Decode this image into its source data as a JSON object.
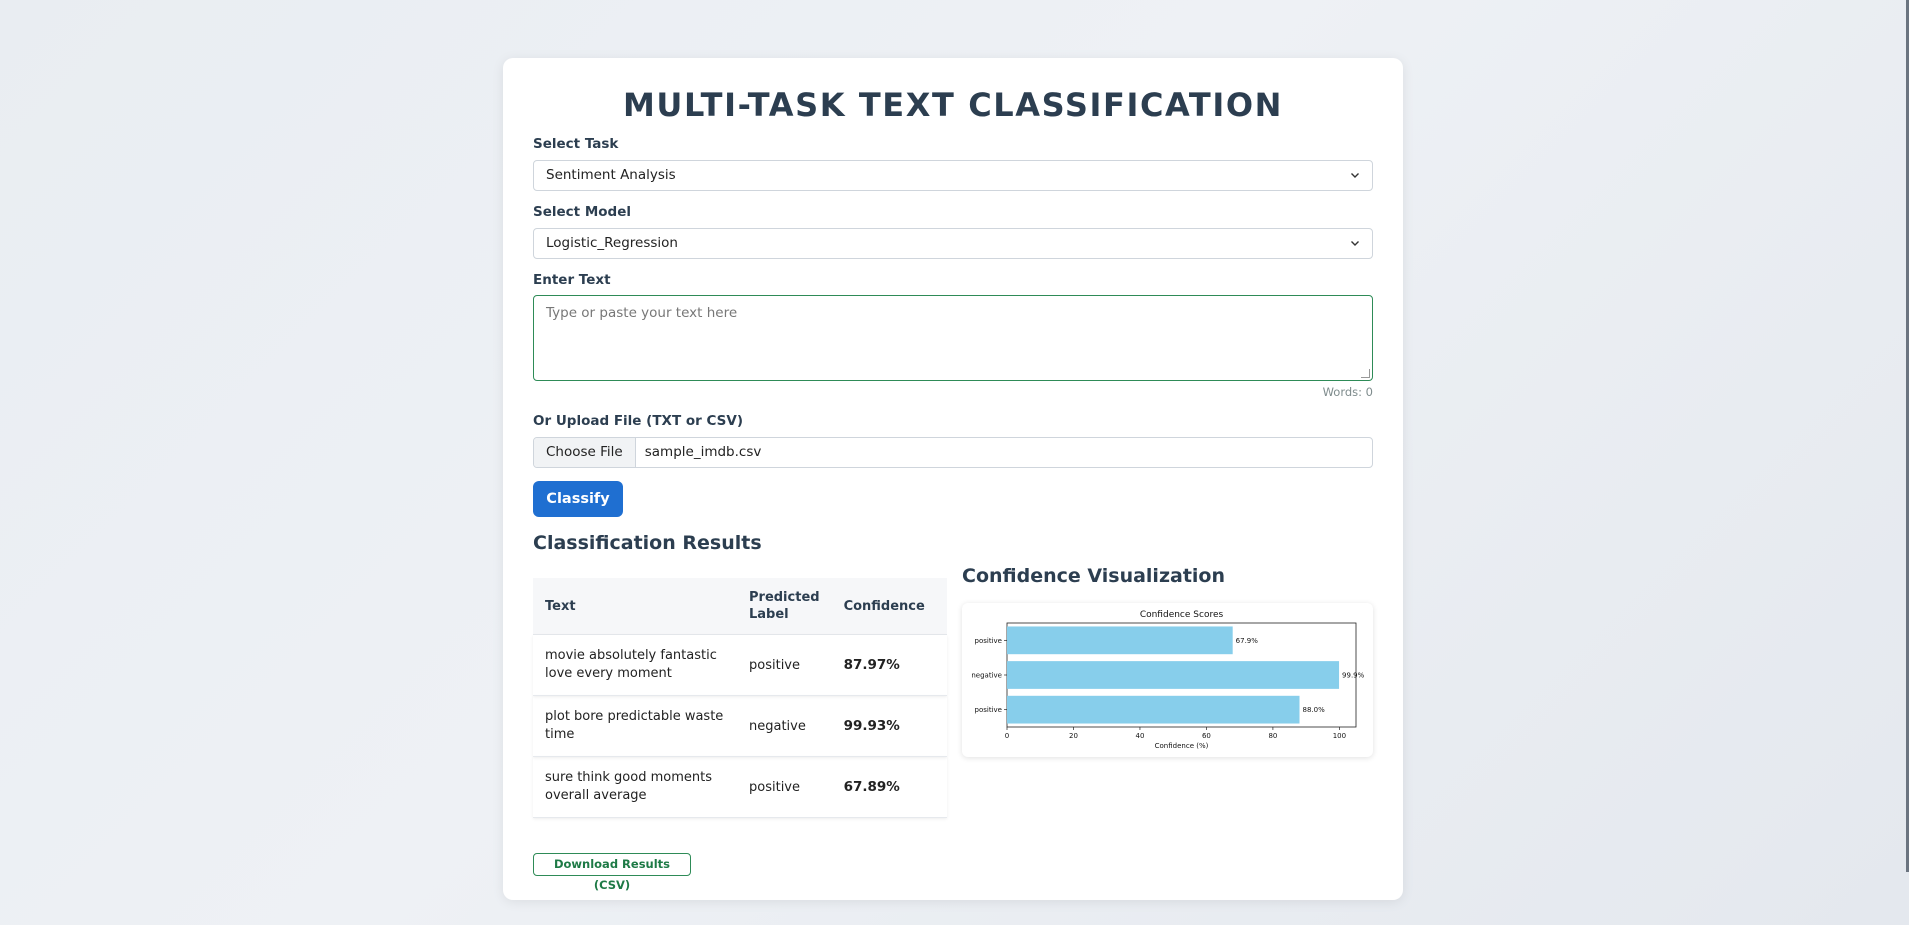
{
  "app": {
    "title": "MULTI-TASK TEXT CLASSIFICATION"
  },
  "task": {
    "label": "Select Task",
    "value": "Sentiment Analysis",
    "icon": "chevron-down-icon"
  },
  "model": {
    "label": "Select Model",
    "value": "Logistic_Regression",
    "icon": "chevron-down-icon"
  },
  "text_input": {
    "label": "Enter Text",
    "placeholder": "Type or paste your text here",
    "value": "",
    "word_count": "Words: 0"
  },
  "upload": {
    "label": "Or Upload File (TXT or CSV)",
    "button": "Choose File",
    "filename": "sample_imdb.csv"
  },
  "classify_button": "Classify",
  "results": {
    "title": "Classification Results",
    "columns": [
      "Text",
      "Predicted Label",
      "Confidence"
    ],
    "rows": [
      {
        "text": "movie absolutely fantastic love every moment",
        "label": "positive",
        "confidence": "87.97%"
      },
      {
        "text": "plot bore predictable waste time",
        "label": "negative",
        "confidence": "99.93%"
      },
      {
        "text": "sure think good moments overall average",
        "label": "positive",
        "confidence": "67.89%"
      }
    ]
  },
  "visualization": {
    "title": "Confidence Visualization"
  },
  "download_button": "Download Results (CSV)",
  "colors": {
    "accent": "#1f6fd1",
    "success": "#2e8b57",
    "bar": "#87ceeb",
    "heading": "#2c3e50"
  },
  "chart_data": {
    "type": "bar",
    "orientation": "horizontal",
    "title": "Confidence Scores",
    "xlabel": "Confidence (%)",
    "ylabel": "",
    "categories": [
      "positive",
      "negative",
      "positive"
    ],
    "values": [
      67.9,
      99.9,
      88.0
    ],
    "data_labels": [
      "67.9%",
      "99.9%",
      "88.0%"
    ],
    "xlim": [
      0,
      105
    ],
    "xticks": [
      0,
      20,
      40,
      60,
      80,
      100
    ],
    "grid": false
  }
}
